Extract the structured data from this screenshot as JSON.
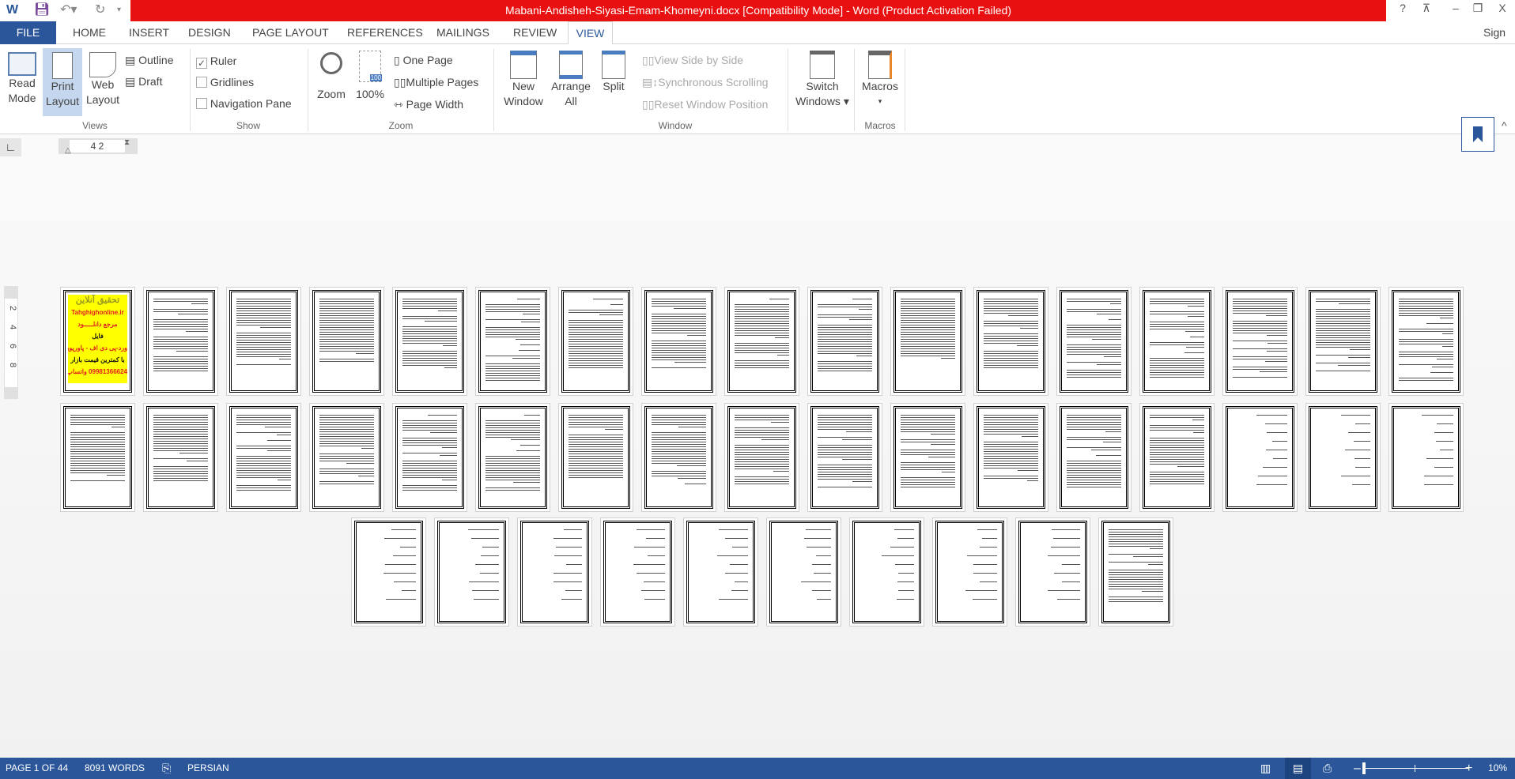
{
  "title": "Mabani-Andisheh-Siyasi-Emam-Khomeyni.docx [Compatibility Mode] -  Word (Product Activation Failed)",
  "window_controls": {
    "help": "?",
    "ribbon_display": "⊼",
    "minimize": "–",
    "restore": "❐",
    "close": "X"
  },
  "tabs": [
    "FILE",
    "HOME",
    "INSERT",
    "DESIGN",
    "PAGE LAYOUT",
    "REFERENCES",
    "MAILINGS",
    "REVIEW",
    "VIEW"
  ],
  "active_tab": "VIEW",
  "sign_in": "Sign in",
  "ribbon": {
    "views": {
      "label": "Views",
      "read_mode": [
        "Read",
        "Mode"
      ],
      "print_layout": [
        "Print",
        "Layout"
      ],
      "web_layout": [
        "Web",
        "Layout"
      ],
      "outline": "Outline",
      "draft": "Draft"
    },
    "show": {
      "label": "Show",
      "ruler": "Ruler",
      "ruler_checked": true,
      "gridlines": "Gridlines",
      "gridlines_checked": false,
      "navigation_pane": "Navigation Pane",
      "navigation_checked": false
    },
    "zoom": {
      "label": "Zoom",
      "zoom": "Zoom",
      "hundred": "100%",
      "hundred_badge": "100",
      "one_page": "One Page",
      "multiple_pages": "Multiple Pages",
      "page_width": "Page Width"
    },
    "window": {
      "label": "Window",
      "new_window": [
        "New",
        "Window"
      ],
      "arrange_all": [
        "Arrange",
        "All"
      ],
      "split": "Split",
      "side_by_side": "View Side by Side",
      "sync_scroll": "Synchronous Scrolling",
      "reset_pos": "Reset Window Position",
      "switch_windows": [
        "Switch",
        "Windows ▾"
      ]
    },
    "macros": {
      "label": "Macros",
      "macros": "Macros",
      "arrow": "▾"
    }
  },
  "ruler": {
    "h": "4   2",
    "v": [
      "2",
      "4",
      "6",
      "8"
    ],
    "tab_selector": "∟"
  },
  "cover": {
    "lines": [
      "تحقیق آنلاین",
      "Tahghighonline.ir",
      "مرجع دانلـــــود",
      "فایل",
      "ورد-پی دی اف - پاورپوینت",
      "با کمترین قیمت بازار",
      "09981366624 واتساپ"
    ],
    "bg": "#ffff00"
  },
  "pages": [
    "cover",
    "text",
    "text",
    "text",
    "text",
    "text",
    "text",
    "text",
    "text",
    "text",
    "text",
    "text",
    "text",
    "text",
    "text",
    "text",
    "text",
    "text",
    "text",
    "text",
    "text",
    "text",
    "text",
    "text",
    "text",
    "text",
    "text",
    "text",
    "text",
    "text",
    "text",
    "list",
    "list",
    "list",
    "list",
    "list",
    "list",
    "list",
    "list",
    "list",
    "list",
    "list",
    "list",
    "text"
  ],
  "status": {
    "page": "PAGE 1 OF 44",
    "words": "8091 WORDS",
    "language": "PERSIAN",
    "zoom": "10%",
    "zoom_percent": 10
  },
  "colors": {
    "brand": "#2b579a",
    "titlebar": "#e81010"
  }
}
